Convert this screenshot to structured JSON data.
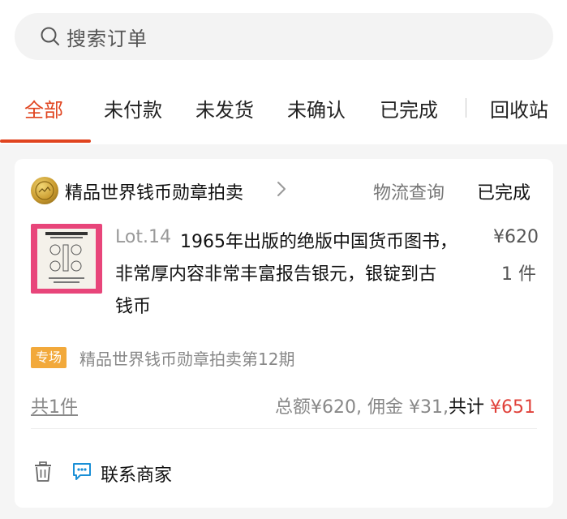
{
  "search": {
    "placeholder": "搜索订单"
  },
  "tabs": [
    {
      "label": "全部",
      "active": true
    },
    {
      "label": "未付款"
    },
    {
      "label": "未发货"
    },
    {
      "label": "未确认"
    },
    {
      "label": "已完成"
    },
    {
      "label": "回收站"
    }
  ],
  "order": {
    "seller_name": "精品世界钱币勋章拍卖",
    "logistics_label": "物流查询",
    "status": "已完成",
    "item": {
      "lot": "Lot.14",
      "title_lines": [
        "1965年出版的绝版中国货币图书，",
        "非常厚内容非常丰富报告银元，银锭到古",
        "钱币"
      ],
      "price": "¥620",
      "quantity": "1 件"
    },
    "tag": "专场",
    "session": "精品世界钱币勋章拍卖第12期",
    "count_text": "共1件",
    "totals": {
      "amount_text": "总额¥620, 佣金 ¥31,",
      "total_label": "共计",
      "total_value": "¥651"
    },
    "actions": {
      "contact_label": "联系商家"
    }
  },
  "colors": {
    "accent": "#e0441f",
    "price_red": "#e0413a",
    "tag_orange": "#f2a93b"
  }
}
